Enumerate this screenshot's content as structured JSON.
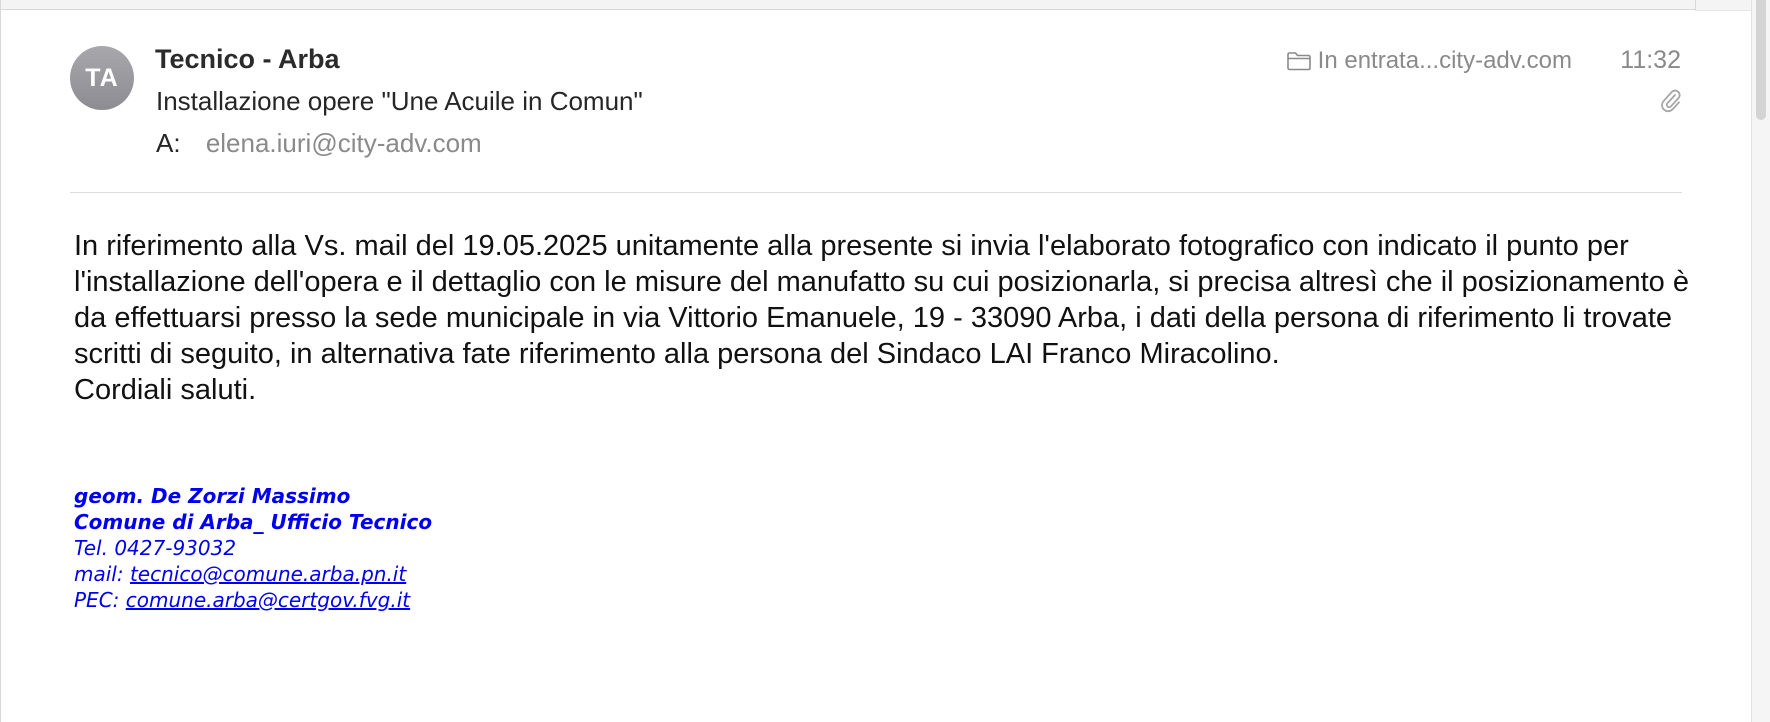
{
  "message": {
    "avatar_initials": "TA",
    "sender": "Tecnico - Arba",
    "subject": "Installazione opere \"Une Acuile in Comun\"",
    "to_label": "A:",
    "to_value": "elena.iuri@city-adv.com",
    "mailbox": "In entrata...city-adv.com",
    "time": "11:32",
    "has_attachment": true
  },
  "body": {
    "paragraph": "In riferimento alla Vs. mail del 19.05.2025 unitamente alla presente si invia l'elaborato fotografico con indicato il punto per l'installazione dell'opera e il dettaglio con le misure del manufatto su cui posizionarla, si precisa altresì che il posizionamento è da effettuarsi presso la sede municipale in via Vittorio Emanuele, 19 - 33090 Arba, i dati della persona di riferimento li trovate scritti di seguito, in alternativa fate riferimento alla persona del Sindaco LAI Franco Miracolino.",
    "closing": "Cordiali saluti."
  },
  "signature": {
    "name": "geom. De Zorzi Massimo",
    "office": "Comune di Arba_ Ufficio Tecnico",
    "tel": "Tel. 0427-93032",
    "mail_label": "mail: ",
    "mail_link": "tecnico@comune.arba.pn.it",
    "pec_label": "PEC: ",
    "pec_link": "comune.arba@certgov.fvg.it"
  },
  "icons": {
    "folder": "folder-icon",
    "attachment": "paperclip-icon"
  },
  "colors": {
    "avatar_bg": "#9a9aa0",
    "signature_blue": "#0000ee",
    "muted_text": "#8a8a8a"
  }
}
